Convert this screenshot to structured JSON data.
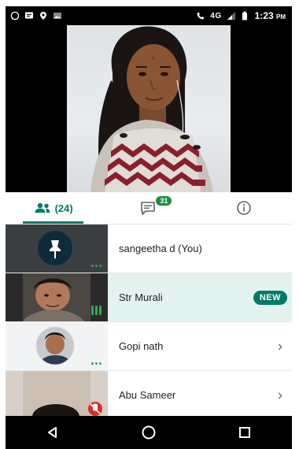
{
  "status_bar": {
    "network_label": "4G",
    "time": "1:23",
    "time_suffix": "PM"
  },
  "tabs": {
    "people_count": "(24)",
    "chat_count": "31"
  },
  "participants": [
    {
      "name": "sangeetha d (You)",
      "badge": "",
      "has_chevron": false
    },
    {
      "name": "Str Murali",
      "badge": "NEW",
      "has_chevron": false
    },
    {
      "name": "Gopi nath",
      "badge": "",
      "has_chevron": true
    },
    {
      "name": "Abu Sameer",
      "badge": "",
      "has_chevron": true
    }
  ],
  "colors": {
    "accent": "#00796b",
    "speaking": "#34a853",
    "highlight_row": "#e4f2ef",
    "muted": "#d93025"
  }
}
